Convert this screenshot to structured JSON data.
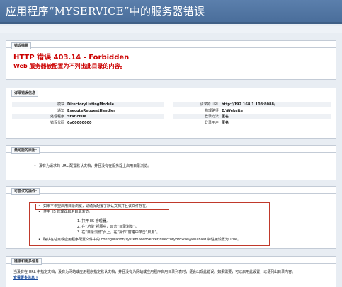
{
  "window": {
    "title": "应用程序“MYSERVICE”中的服务器错误"
  },
  "summary": {
    "tab": "错误摘要",
    "status_title": "HTTP 错误 403.14 - Forbidden",
    "status_desc": "Web 服务器被配置为不列出此目录的内容。"
  },
  "details": {
    "tab": "详细错误信息",
    "left": [
      {
        "label": "模块",
        "value": "DirectoryListingModule"
      },
      {
        "label": "通知",
        "value": "ExecuteRequestHandler"
      },
      {
        "label": "处理程序",
        "value": "StaticFile"
      },
      {
        "label": "错误代码",
        "value": "0x00000000"
      }
    ],
    "right": [
      {
        "label": "请求的 URL",
        "value": "http://192.168.1.108:8088/"
      },
      {
        "label": "物理路径",
        "value": "E:\\Website"
      },
      {
        "label": "登录方法",
        "value": "匿名"
      },
      {
        "label": "登录用户",
        "value": "匿名"
      }
    ]
  },
  "causes": {
    "tab": "最可能的原因:",
    "items": [
      "没有为请求的 URL 配置默认文档，并且没有在服务器上启用目录浏览。"
    ]
  },
  "actions": {
    "tab": "可尝试的操作:",
    "items": [
      "如果不希望启用目录浏览，请确保配置了默认文档并且该文件存在。",
      "使用 IIS 管理器启用目录浏览。",
      "确认在站点或应用程序配置文件中的 configuration/system.webServer/directoryBrowse@enabled 特性被设置为 True。"
    ],
    "steps": [
      "1. 打开 IIS 管理器。",
      "2. 在“功能”视图中，双击“目录浏览”。",
      "3. 在“目录浏览”页上，在“操作”窗格中单击“启用”。"
    ]
  },
  "links": {
    "tab": "链接和更多信息",
    "text": "当没有在 URL 中指定文档，没有为网站或应用程序指定默认文档，并且没有为网站或应用程序启用目录列表时，便会出现此错误。如果需要，可以启用此设置，以便列出目录内容。",
    "link": "查看更多信息 »"
  }
}
